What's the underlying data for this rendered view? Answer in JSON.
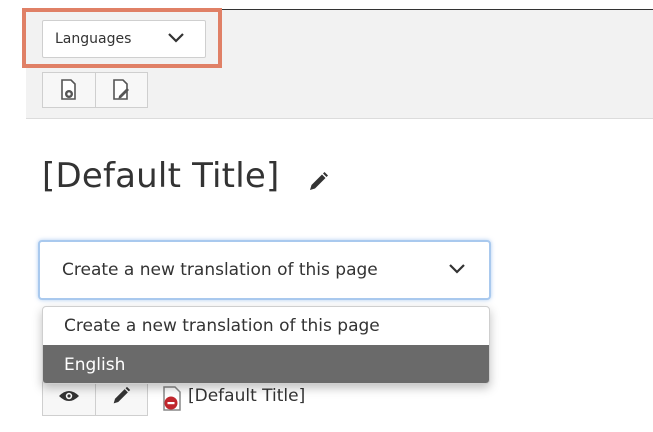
{
  "toolbar": {
    "languages_label": "Languages",
    "languages_icon": "chevron-down-icon",
    "view_icon": "page-view-icon",
    "edit_icon": "page-edit-icon"
  },
  "page": {
    "title": "[Default Title]",
    "title_edit_icon": "pencil-icon"
  },
  "translation_select": {
    "selected_value": "Create a new translation of this page",
    "options": [
      "Create a new translation of this page",
      "English"
    ],
    "highlighted_option": "English"
  },
  "row": {
    "title": "[Default Title]",
    "view_icon": "eye-icon",
    "edit_icon": "pencil-icon",
    "status_icon": "page-no-access-icon"
  },
  "colors": {
    "highlight_border": "#e08066",
    "select_focus": "#a9c9ee",
    "dropdown_highlight": "#6a6a6a",
    "toolbar_bg": "#f2f2f2"
  }
}
